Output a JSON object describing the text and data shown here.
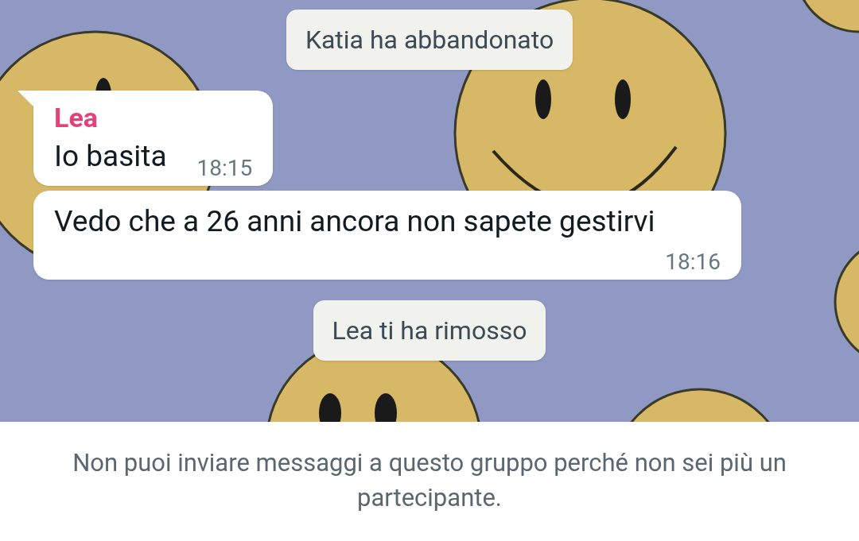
{
  "messages": [
    {
      "kind": "system",
      "text": "Katia ha abbandonato"
    },
    {
      "kind": "incoming",
      "tail": true,
      "sender": "Lea",
      "text": "Io basita",
      "time": "18:15"
    },
    {
      "kind": "incoming",
      "tail": false,
      "text": "Vedo che a 26 anni ancora non sapete gestirvi",
      "time": "18:16"
    },
    {
      "kind": "system",
      "text": "Lea ti ha rimosso"
    }
  ],
  "footer_notice": "Non puoi inviare messaggi a questo gruppo perché non sei più un partecipante."
}
